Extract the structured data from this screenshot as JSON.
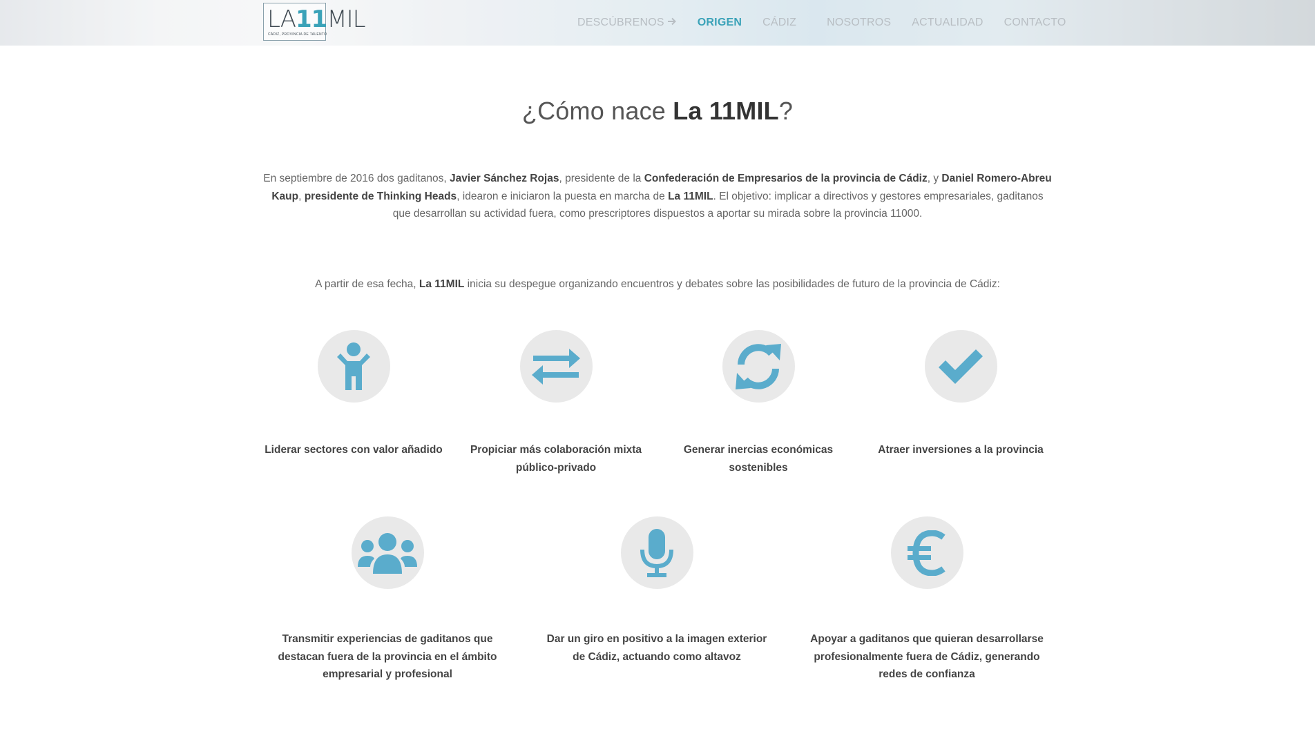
{
  "header": {
    "logo": {
      "text_left": "LA",
      "text_num": "11",
      "text_right": "MIL",
      "tagline": "Cádiz, provincia de talento"
    },
    "nav": [
      {
        "label": "Descúbrenos",
        "icon": "arrow-right-icon"
      },
      {
        "label": "Origen"
      },
      {
        "label": "Cádiz"
      },
      {
        "label": "Nosotros"
      },
      {
        "label": "Actualidad"
      },
      {
        "label": "Contacto"
      }
    ],
    "colors": {
      "accent": "#3aa2b8",
      "nav_inactive": "#b8bec3"
    }
  },
  "main": {
    "title_prefix": "¿Cómo nace ",
    "title_bold": "La 11MIL",
    "title_suffix": "?",
    "intro": {
      "t1": "En septiembre de 2016 dos gaditanos, ",
      "b1": "Javier Sánchez Rojas",
      "t2": ", presidente de la ",
      "b2": "Confederación de Empresarios de la provincia de Cádiz",
      "t3": ", y ",
      "b3": "Daniel Romero-Abreu Kaup",
      "t4": ", ",
      "b4": "presidente de Thinking Heads",
      "t5": ", idearon e iniciaron la puesta en marcha de ",
      "b5": "La 11MIL",
      "t6": ". El objetivo: implicar a directivos y gestores empresariales, gaditanos que desarrollan su actividad fuera, como prescriptores dispuestos a aportar su mirada sobre la provincia 11000."
    },
    "subintro": {
      "t1": "A partir de esa fecha, ",
      "b1": "La 11MIL",
      "t2": " inicia su despegue organizando encuentros y debates sobre las posibilidades de futuro de la provincia de Cádiz:"
    },
    "features_row1": [
      {
        "icon": "child-icon",
        "label": "Liderar sectores con valor añadido"
      },
      {
        "icon": "exchange-arrows-icon",
        "label": "Propiciar más colaboración mixta público-privado"
      },
      {
        "icon": "refresh-icon",
        "label": "Generar inercias económicas sostenibles"
      },
      {
        "icon": "checkmark-icon",
        "label": "Atraer inversiones a la provincia"
      }
    ],
    "features_row2": [
      {
        "icon": "users-group-icon",
        "label": "Transmitir experiencias de gaditanos que destacan fuera de la provincia en el ámbito empresarial y profesional"
      },
      {
        "icon": "microphone-icon",
        "label": "Dar un giro en positivo a la imagen exterior de Cádiz, actuando como altavoz"
      },
      {
        "icon": "euro-icon",
        "label": "Apoyar a gaditanos que quieran desarrollarse profesionalmente fuera de Cádiz, generando redes de confianza"
      }
    ],
    "icon_color": "#5aaccc",
    "circle_color": "#e9e9e9"
  }
}
